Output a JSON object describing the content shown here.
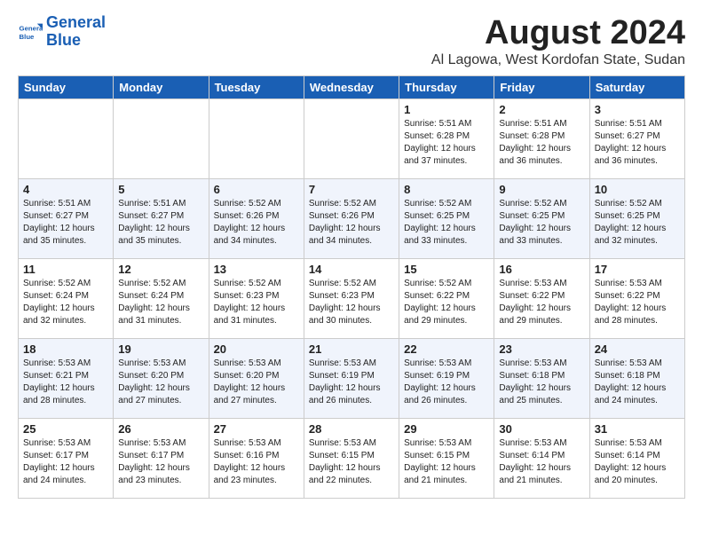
{
  "logo": {
    "line1": "General",
    "line2": "Blue"
  },
  "title": "August 2024",
  "location": "Al Lagowa, West Kordofan State, Sudan",
  "headers": [
    "Sunday",
    "Monday",
    "Tuesday",
    "Wednesday",
    "Thursday",
    "Friday",
    "Saturday"
  ],
  "weeks": [
    [
      {
        "day": "",
        "info": ""
      },
      {
        "day": "",
        "info": ""
      },
      {
        "day": "",
        "info": ""
      },
      {
        "day": "",
        "info": ""
      },
      {
        "day": "1",
        "info": "Sunrise: 5:51 AM\nSunset: 6:28 PM\nDaylight: 12 hours\nand 37 minutes."
      },
      {
        "day": "2",
        "info": "Sunrise: 5:51 AM\nSunset: 6:28 PM\nDaylight: 12 hours\nand 36 minutes."
      },
      {
        "day": "3",
        "info": "Sunrise: 5:51 AM\nSunset: 6:27 PM\nDaylight: 12 hours\nand 36 minutes."
      }
    ],
    [
      {
        "day": "4",
        "info": "Sunrise: 5:51 AM\nSunset: 6:27 PM\nDaylight: 12 hours\nand 35 minutes."
      },
      {
        "day": "5",
        "info": "Sunrise: 5:51 AM\nSunset: 6:27 PM\nDaylight: 12 hours\nand 35 minutes."
      },
      {
        "day": "6",
        "info": "Sunrise: 5:52 AM\nSunset: 6:26 PM\nDaylight: 12 hours\nand 34 minutes."
      },
      {
        "day": "7",
        "info": "Sunrise: 5:52 AM\nSunset: 6:26 PM\nDaylight: 12 hours\nand 34 minutes."
      },
      {
        "day": "8",
        "info": "Sunrise: 5:52 AM\nSunset: 6:25 PM\nDaylight: 12 hours\nand 33 minutes."
      },
      {
        "day": "9",
        "info": "Sunrise: 5:52 AM\nSunset: 6:25 PM\nDaylight: 12 hours\nand 33 minutes."
      },
      {
        "day": "10",
        "info": "Sunrise: 5:52 AM\nSunset: 6:25 PM\nDaylight: 12 hours\nand 32 minutes."
      }
    ],
    [
      {
        "day": "11",
        "info": "Sunrise: 5:52 AM\nSunset: 6:24 PM\nDaylight: 12 hours\nand 32 minutes."
      },
      {
        "day": "12",
        "info": "Sunrise: 5:52 AM\nSunset: 6:24 PM\nDaylight: 12 hours\nand 31 minutes."
      },
      {
        "day": "13",
        "info": "Sunrise: 5:52 AM\nSunset: 6:23 PM\nDaylight: 12 hours\nand 31 minutes."
      },
      {
        "day": "14",
        "info": "Sunrise: 5:52 AM\nSunset: 6:23 PM\nDaylight: 12 hours\nand 30 minutes."
      },
      {
        "day": "15",
        "info": "Sunrise: 5:52 AM\nSunset: 6:22 PM\nDaylight: 12 hours\nand 29 minutes."
      },
      {
        "day": "16",
        "info": "Sunrise: 5:53 AM\nSunset: 6:22 PM\nDaylight: 12 hours\nand 29 minutes."
      },
      {
        "day": "17",
        "info": "Sunrise: 5:53 AM\nSunset: 6:22 PM\nDaylight: 12 hours\nand 28 minutes."
      }
    ],
    [
      {
        "day": "18",
        "info": "Sunrise: 5:53 AM\nSunset: 6:21 PM\nDaylight: 12 hours\nand 28 minutes."
      },
      {
        "day": "19",
        "info": "Sunrise: 5:53 AM\nSunset: 6:20 PM\nDaylight: 12 hours\nand 27 minutes."
      },
      {
        "day": "20",
        "info": "Sunrise: 5:53 AM\nSunset: 6:20 PM\nDaylight: 12 hours\nand 27 minutes."
      },
      {
        "day": "21",
        "info": "Sunrise: 5:53 AM\nSunset: 6:19 PM\nDaylight: 12 hours\nand 26 minutes."
      },
      {
        "day": "22",
        "info": "Sunrise: 5:53 AM\nSunset: 6:19 PM\nDaylight: 12 hours\nand 26 minutes."
      },
      {
        "day": "23",
        "info": "Sunrise: 5:53 AM\nSunset: 6:18 PM\nDaylight: 12 hours\nand 25 minutes."
      },
      {
        "day": "24",
        "info": "Sunrise: 5:53 AM\nSunset: 6:18 PM\nDaylight: 12 hours\nand 24 minutes."
      }
    ],
    [
      {
        "day": "25",
        "info": "Sunrise: 5:53 AM\nSunset: 6:17 PM\nDaylight: 12 hours\nand 24 minutes."
      },
      {
        "day": "26",
        "info": "Sunrise: 5:53 AM\nSunset: 6:17 PM\nDaylight: 12 hours\nand 23 minutes."
      },
      {
        "day": "27",
        "info": "Sunrise: 5:53 AM\nSunset: 6:16 PM\nDaylight: 12 hours\nand 23 minutes."
      },
      {
        "day": "28",
        "info": "Sunrise: 5:53 AM\nSunset: 6:15 PM\nDaylight: 12 hours\nand 22 minutes."
      },
      {
        "day": "29",
        "info": "Sunrise: 5:53 AM\nSunset: 6:15 PM\nDaylight: 12 hours\nand 21 minutes."
      },
      {
        "day": "30",
        "info": "Sunrise: 5:53 AM\nSunset: 6:14 PM\nDaylight: 12 hours\nand 21 minutes."
      },
      {
        "day": "31",
        "info": "Sunrise: 5:53 AM\nSunset: 6:14 PM\nDaylight: 12 hours\nand 20 minutes."
      }
    ]
  ]
}
